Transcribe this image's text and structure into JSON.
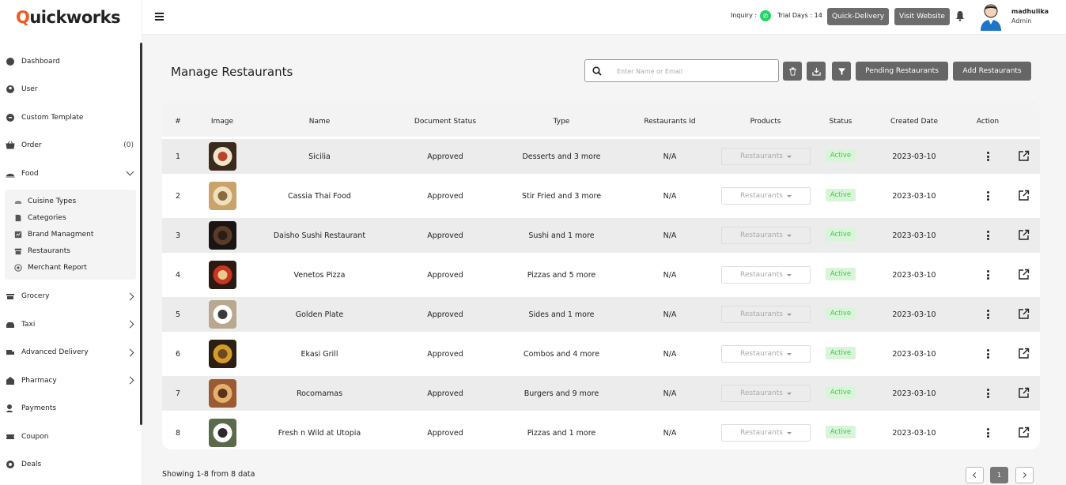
{
  "brand": {
    "q": "Q",
    "rest": "uickworks"
  },
  "sidebar": {
    "items": [
      {
        "label": "Dashboard",
        "icon": "dashboard-icon"
      },
      {
        "label": "User",
        "icon": "user-icon"
      },
      {
        "label": "Custom Template",
        "icon": "template-icon"
      },
      {
        "label": "Order",
        "icon": "basket-icon",
        "count": "(0)"
      },
      {
        "label": "Food",
        "icon": "food-icon",
        "expanded": true
      }
    ],
    "food_sub": [
      {
        "label": "Cuisine Types",
        "icon": "cuisine-icon"
      },
      {
        "label": "Categories",
        "icon": "categories-icon"
      },
      {
        "label": "Brand Managment",
        "icon": "brand-icon"
      },
      {
        "label": "Restaurants",
        "icon": "restaurant-icon"
      },
      {
        "label": "Merchant Report",
        "icon": "report-icon"
      }
    ],
    "after": [
      {
        "label": "Grocery",
        "icon": "grocery-icon",
        "chevron": true
      },
      {
        "label": "Taxi",
        "icon": "taxi-icon",
        "chevron": true
      },
      {
        "label": "Advanced Delivery",
        "icon": "delivery-icon",
        "chevron": true
      },
      {
        "label": "Pharmacy",
        "icon": "pharmacy-icon",
        "chevron": true
      },
      {
        "label": "Payments",
        "icon": "payments-icon"
      },
      {
        "label": "Coupon",
        "icon": "coupon-icon"
      },
      {
        "label": "Deals",
        "icon": "deals-icon"
      }
    ]
  },
  "topbar": {
    "inquiry": "Inquiry :",
    "trial": "Trial Days : 14",
    "quick_delivery": "Quick-Delivery",
    "visit_website": "Visit Website",
    "user_name": "madhulika",
    "user_role": "Admin"
  },
  "page": {
    "title": "Manage Restaurants",
    "search_placeholder": "Enter Name or Email",
    "pending_label": "Pending Restaurants",
    "add_label": "Add Restaurants"
  },
  "table": {
    "headers": [
      "#",
      "Image",
      "Name",
      "Document Status",
      "Type",
      "Restaurants Id",
      "Products",
      "Status",
      "Created Date",
      "Action"
    ],
    "rows": [
      {
        "num": "1",
        "name": "Sicilia",
        "doc": "Approved",
        "type": "Desserts and 3 more",
        "rid": "N/A",
        "products": "Restaurants",
        "status": "Active",
        "date": "2023-03-10"
      },
      {
        "num": "2",
        "name": "Cassia Thai Food",
        "doc": "Approved",
        "type": "Stir Fried and 3 more",
        "rid": "N/A",
        "products": "Restaurants",
        "status": "Active",
        "date": "2023-03-10"
      },
      {
        "num": "3",
        "name": "Daisho Sushi Restaurant",
        "doc": "Approved",
        "type": "Sushi and 1 more",
        "rid": "N/A",
        "products": "Restaurants",
        "status": "Active",
        "date": "2023-03-10"
      },
      {
        "num": "4",
        "name": "Venetos Pizza",
        "doc": "Approved",
        "type": "Pizzas and 5 more",
        "rid": "N/A",
        "products": "Restaurants",
        "status": "Active",
        "date": "2023-03-10"
      },
      {
        "num": "5",
        "name": "Golden Plate",
        "doc": "Approved",
        "type": "Sides and 1 more",
        "rid": "N/A",
        "products": "Restaurants",
        "status": "Active",
        "date": "2023-03-10"
      },
      {
        "num": "6",
        "name": "Ekasi Grill",
        "doc": "Approved",
        "type": "Combos and 4 more",
        "rid": "N/A",
        "products": "Restaurants",
        "status": "Active",
        "date": "2023-03-10"
      },
      {
        "num": "7",
        "name": "Rocomamas",
        "doc": "Approved",
        "type": "Burgers and 9 more",
        "rid": "N/A",
        "products": "Restaurants",
        "status": "Active",
        "date": "2023-03-10"
      },
      {
        "num": "8",
        "name": "Fresh n Wild at Utopia",
        "doc": "Approved",
        "type": "Pizzas and 1 more",
        "rid": "N/A",
        "products": "Restaurants",
        "status": "Active",
        "date": "2023-03-10"
      }
    ]
  },
  "footer": {
    "showing": "Showing 1-8 from 8 data",
    "page": "1"
  },
  "colors": {
    "accent": "#f05a22",
    "button": "#666666",
    "active_bg": "#d9f5d9",
    "active_text": "#4cc04c"
  }
}
